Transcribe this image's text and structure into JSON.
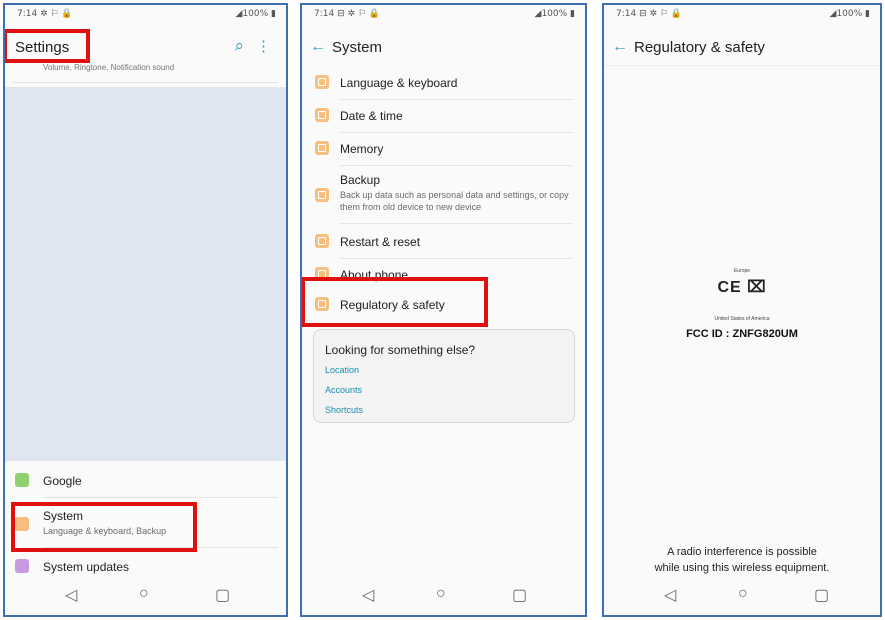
{
  "status": {
    "p1_time": "7:14 ✲ ⚐ 🔒",
    "p2_time": "7:14 ⊟ ✲ ⚐ 🔒",
    "p3_time": "7:14 ⊟ ✲ ⚐ 🔒",
    "battery": "◢100% ▮"
  },
  "settings": {
    "title": "Settings",
    "sound_subtext": "Volume, Ringtone, Notification sound",
    "google_label": "Google",
    "system_label": "System",
    "system_sub": "Language & keyboard, Backup",
    "updates_label": "System updates",
    "search_icon": "⌕",
    "more_icon": "⋮"
  },
  "system": {
    "title": "System",
    "items": [
      {
        "label": "Language & keyboard"
      },
      {
        "label": "Date & time"
      },
      {
        "label": "Memory"
      },
      {
        "label": "Backup",
        "sub": "Back up data such as personal data and settings, or copy them from old device to new device"
      },
      {
        "label": "Restart & reset"
      },
      {
        "label": "About phone"
      },
      {
        "label": "Regulatory & safety"
      }
    ],
    "card_title": "Looking for something else?",
    "links": [
      "Location",
      "Accounts",
      "Shortcuts"
    ]
  },
  "regulatory": {
    "title": "Regulatory & safety",
    "europe": "Europe",
    "ce": "CE ⌧",
    "usa": "United States of America",
    "fcc": "FCC ID : ZNFG820UM",
    "notice_line1": "A radio interference is possible",
    "notice_line2": "while using this wireless equipment."
  },
  "nav": {
    "back": "◁",
    "home": "○",
    "recent": "▢"
  },
  "colors": {
    "accent": "#2aa1b8",
    "icon_orange": "#f7bf7e",
    "highlight": "#e01010",
    "link": "#1b8fb3"
  }
}
